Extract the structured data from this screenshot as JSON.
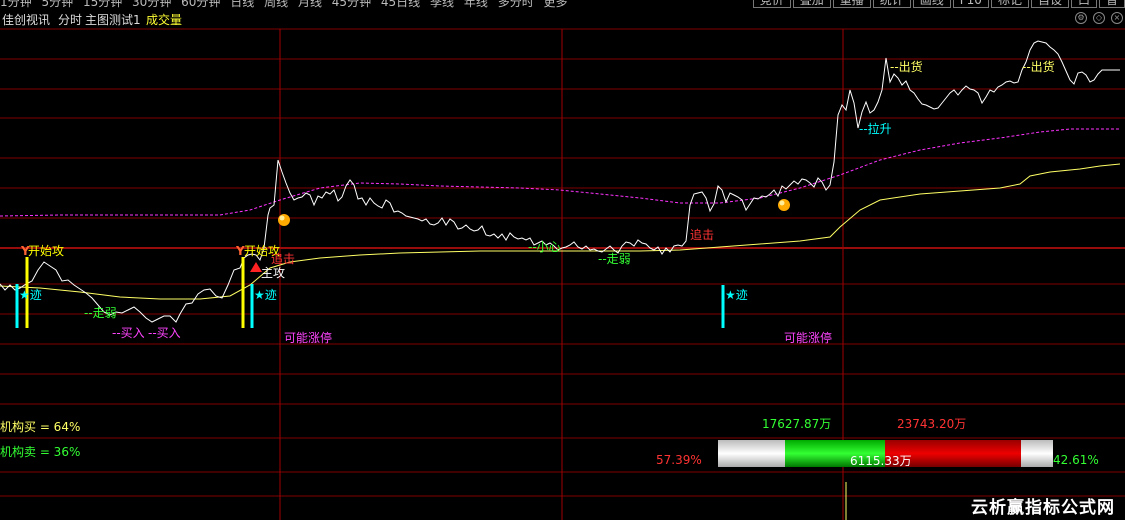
{
  "toolbar": {
    "periods": [
      "1分钟",
      "5分钟",
      "15分钟",
      "30分钟",
      "60分钟",
      "日线",
      "周线",
      "月线",
      "45分钟",
      "45日线",
      "季线",
      "年线",
      "多分时",
      "更多"
    ],
    "buttons": [
      "竞价",
      "叠加",
      "重播",
      "统计",
      "画线",
      "F10",
      "标记",
      "自设",
      "口",
      "普"
    ]
  },
  "topbar": {
    "title": "佳创视讯",
    "mode": "分时",
    "indicator": "主图测试1",
    "volume_label": "成交量"
  },
  "colors": {
    "price_line": "#ffffff",
    "avg_line": "#ffff66",
    "ma_dash": "#ff33ff",
    "grid": "#800000",
    "grid_v": "#a00000",
    "yellow": "#ffff00",
    "cyan": "#00ffff",
    "magenta": "#ff44ff",
    "green": "#33ff33",
    "red": "#ff3333"
  },
  "annotations": {
    "start_attack_1": "开始攻",
    "start_attack_2": "开始攻",
    "trace_1": "迹",
    "trace_2": "迹",
    "trace_3": "迹",
    "weak_1": "--走弱",
    "weak_2": "--走弱",
    "careful": "--小心",
    "buy_1": "--买入",
    "buy_2": "--买入",
    "chase_1": "追击",
    "chase_2": "追击",
    "main_attack": "主攻",
    "limit_up_1": "可能涨停",
    "limit_up_2": "可能涨停",
    "ship_1": "--出货",
    "ship_2": "--出货",
    "pull_up": "--拉升"
  },
  "stats": {
    "inst_buy": "机构买 = 64%",
    "inst_sell": "机构卖 = 36%",
    "buy_amount": "17627.87万",
    "sell_amount": "23743.20万",
    "net_amount": "6115.33万",
    "buy_pct": "57.39%",
    "sell_pct": "42.61%"
  },
  "watermark": "云析赢指标公式网"
}
